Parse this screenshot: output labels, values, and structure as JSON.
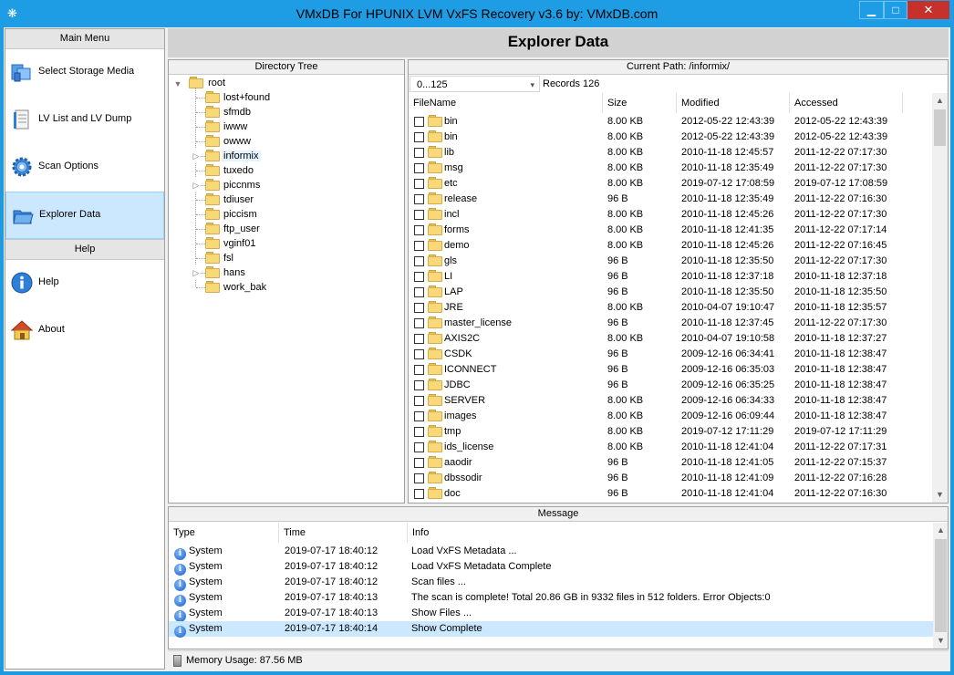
{
  "window": {
    "title": "VMxDB For HPUNIX LVM VxFS Recovery v3.6 by: VMxDB.com",
    "minimize_glyph": "▁",
    "maximize_glyph": "□",
    "close_glyph": "✕"
  },
  "colors": {
    "titlebar": "#1e9ce4",
    "close": "#c7312c",
    "selection": "#cce8ff"
  },
  "sidebar": {
    "main_menu_header": "Main Menu",
    "help_header": "Help",
    "main_items": [
      {
        "label": "Select Storage Media",
        "icon": "storage-media-icon"
      },
      {
        "label": "LV List and LV Dump",
        "icon": "lv-list-icon"
      },
      {
        "label": "Scan Options",
        "icon": "gear-icon"
      },
      {
        "label": "Explorer Data",
        "icon": "explorer-icon",
        "active": true
      }
    ],
    "help_items": [
      {
        "label": "Help",
        "icon": "info-icon"
      },
      {
        "label": "About",
        "icon": "home-icon"
      }
    ]
  },
  "header": {
    "title": "Explorer Data"
  },
  "tree": {
    "title": "Directory Tree",
    "root": "root",
    "items": [
      {
        "name": "lost+found",
        "expandable": false
      },
      {
        "name": "sfmdb",
        "expandable": false
      },
      {
        "name": "iwww",
        "expandable": false
      },
      {
        "name": "owww",
        "expandable": false
      },
      {
        "name": "informix",
        "expandable": true,
        "selected": true
      },
      {
        "name": "tuxedo",
        "expandable": false
      },
      {
        "name": "piccnms",
        "expandable": true
      },
      {
        "name": "tdiuser",
        "expandable": false
      },
      {
        "name": "piccism",
        "expandable": false
      },
      {
        "name": "ftp_user",
        "expandable": false
      },
      {
        "name": "vginf01",
        "expandable": false
      },
      {
        "name": "fsl",
        "expandable": false
      },
      {
        "name": "hans",
        "expandable": true
      },
      {
        "name": "work_bak",
        "expandable": false
      }
    ]
  },
  "files": {
    "path_label": "Current Path: /informix/",
    "range_select": "0...125",
    "dropdown_glyph": "▾",
    "records": "Records 126",
    "columns": [
      "FileName",
      "Size",
      "Modified",
      "Accessed"
    ],
    "rows": [
      [
        "bin",
        "8.00 KB",
        "2012-05-22 12:43:39",
        "2012-05-22 12:43:39"
      ],
      [
        "bin",
        "8.00 KB",
        "2012-05-22 12:43:39",
        "2012-05-22 12:43:39"
      ],
      [
        "lib",
        "8.00 KB",
        "2010-11-18 12:45:57",
        "2011-12-22 07:17:30"
      ],
      [
        "msg",
        "8.00 KB",
        "2010-11-18 12:35:49",
        "2011-12-22 07:17:30"
      ],
      [
        "etc",
        "8.00 KB",
        "2019-07-12 17:08:59",
        "2019-07-12 17:08:59"
      ],
      [
        "release",
        "96 B",
        "2010-11-18 12:35:49",
        "2011-12-22 07:16:30"
      ],
      [
        "incl",
        "8.00 KB",
        "2010-11-18 12:45:26",
        "2011-12-22 07:17:30"
      ],
      [
        "forms",
        "8.00 KB",
        "2010-11-18 12:41:35",
        "2011-12-22 07:17:14"
      ],
      [
        "demo",
        "8.00 KB",
        "2010-11-18 12:45:26",
        "2011-12-22 07:16:45"
      ],
      [
        "gls",
        "96 B",
        "2010-11-18 12:35:50",
        "2011-12-22 07:17:30"
      ],
      [
        "LI",
        "96 B",
        "2010-11-18 12:37:18",
        "2010-11-18 12:37:18"
      ],
      [
        "LAP",
        "96 B",
        "2010-11-18 12:35:50",
        "2010-11-18 12:35:50"
      ],
      [
        "JRE",
        "8.00 KB",
        "2010-04-07 19:10:47",
        "2010-11-18 12:35:57"
      ],
      [
        "master_license",
        "96 B",
        "2010-11-18 12:37:45",
        "2011-12-22 07:17:30"
      ],
      [
        "AXIS2C",
        "8.00 KB",
        "2010-04-07 19:10:58",
        "2010-11-18 12:37:27"
      ],
      [
        "CSDK",
        "96 B",
        "2009-12-16 06:34:41",
        "2010-11-18 12:38:47"
      ],
      [
        "ICONNECT",
        "96 B",
        "2009-12-16 06:35:03",
        "2010-11-18 12:38:47"
      ],
      [
        "JDBC",
        "96 B",
        "2009-12-16 06:35:25",
        "2010-11-18 12:38:47"
      ],
      [
        "SERVER",
        "8.00 KB",
        "2009-12-16 06:34:33",
        "2010-11-18 12:38:47"
      ],
      [
        "images",
        "8.00 KB",
        "2009-12-16 06:09:44",
        "2010-11-18 12:38:47"
      ],
      [
        "tmp",
        "8.00 KB",
        "2019-07-12 17:11:29",
        "2019-07-12 17:11:29"
      ],
      [
        "ids_license",
        "8.00 KB",
        "2010-11-18 12:41:04",
        "2011-12-22 07:17:31"
      ],
      [
        "aaodir",
        "96 B",
        "2010-11-18 12:41:05",
        "2011-12-22 07:15:37"
      ],
      [
        "dbssodir",
        "96 B",
        "2010-11-18 12:41:09",
        "2011-12-22 07:16:28"
      ],
      [
        "doc",
        "96 B",
        "2010-11-18 12:41:04",
        "2011-12-22 07:16:30"
      ]
    ]
  },
  "messages": {
    "title": "Message",
    "columns": [
      "Type",
      "Time",
      "Info"
    ],
    "rows": [
      [
        "System",
        "2019-07-17 18:40:12",
        "Load VxFS Metadata ..."
      ],
      [
        "System",
        "2019-07-17 18:40:12",
        "Load VxFS Metadata Complete"
      ],
      [
        "System",
        "2019-07-17 18:40:12",
        "Scan files ..."
      ],
      [
        "System",
        "2019-07-17 18:40:13",
        "The scan is complete!  Total 20.86 GB  in 9332 files in 512 folders.  Error Objects:0"
      ],
      [
        "System",
        "2019-07-17 18:40:13",
        "Show Files ..."
      ],
      [
        "System",
        "2019-07-17 18:40:14",
        "Show Complete"
      ]
    ],
    "selected_row": 5
  },
  "status": {
    "memory": "Memory Usage: 87.56 MB"
  }
}
